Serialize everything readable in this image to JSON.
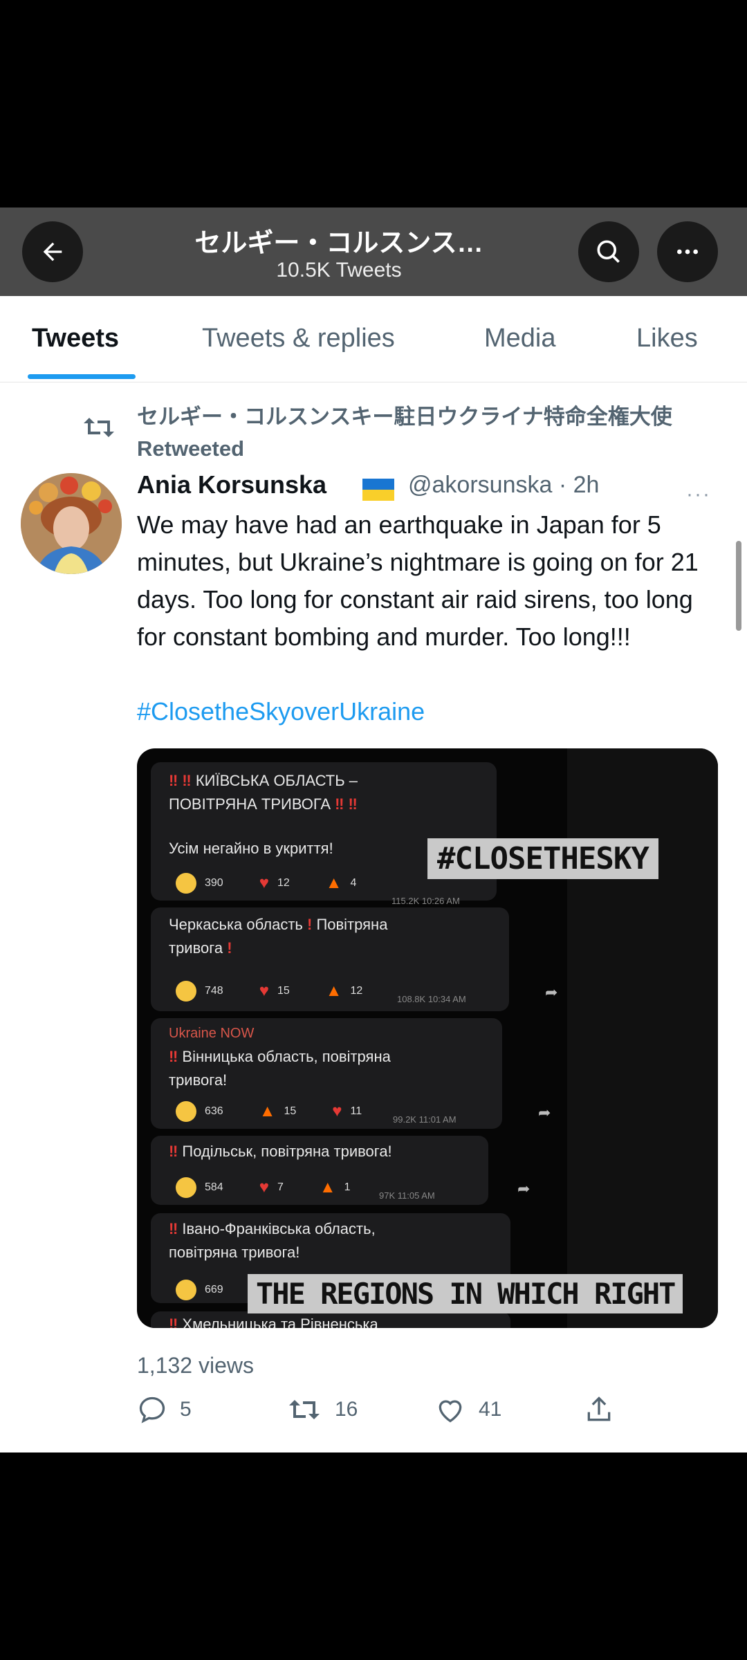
{
  "header": {
    "title": "セルギー・コルスンス…",
    "subtitle": "10.5K Tweets",
    "back_icon": "arrow-left-icon",
    "search_icon": "search-icon",
    "more_icon": "more-horizontal-icon"
  },
  "tabs": [
    {
      "label": "Tweets",
      "active": true
    },
    {
      "label": "Tweets & replies",
      "active": false
    },
    {
      "label": "Media",
      "active": false
    },
    {
      "label": "Likes",
      "active": false
    }
  ],
  "retweet_line": "セルギー・コルスンスキー駐日ウクライナ特命全権大使 Retweeted",
  "tweet": {
    "author_name": "Ania Korsunska",
    "author_handle": "@akorsunska · 2h",
    "more": "···",
    "text": "We may have had an earthquake in Japan for 5 minutes, but Ukraine’s nightmare is going on for 21 days. Too long for constant air raid sirens, too long for constant bombing and murder. Too long!!!",
    "hashtag": "#ClosetheSkyoverUkraine",
    "views": "1,132 views",
    "replies": "5",
    "retweets": "16",
    "likes": "41"
  },
  "media": {
    "overlay_top": "#CLOSETHESKY",
    "overlay_bottom": "THE REGIONS IN WHICH RIGHT",
    "messages": [
      {
        "line1": "КИЇВСЬКА ОБЛАСТЬ –",
        "line2": "ПОВІТРЯНА ТРИВОГА",
        "line3": "Усім негайно в укриття!",
        "r1": "390",
        "r2": "12",
        "r3": "4",
        "meta": "115.2K 10:26 AM"
      },
      {
        "line1": "Черкаська область",
        "line1b": "Повітряна",
        "line2": "тривога",
        "r1": "748",
        "r2": "15",
        "r3": "12",
        "meta": "108.8K 10:34 AM"
      },
      {
        "sender": "Ukraine NOW",
        "line1": "Вінницька область, повітряна",
        "line2": "тривога!",
        "r1": "636",
        "r2": "15",
        "r3": "11",
        "meta": "99.2K 11:01 AM"
      },
      {
        "line1": "Подільськ, повітряна тривога!",
        "r1": "584",
        "r2": "7",
        "r3": "1",
        "meta": "97K 11:05 AM"
      },
      {
        "line1": "Івано-Франківська область,",
        "line2": "повітряна тривога!",
        "r1": "669"
      },
      {
        "line1": "Хмельницька та Рівненська"
      }
    ]
  }
}
